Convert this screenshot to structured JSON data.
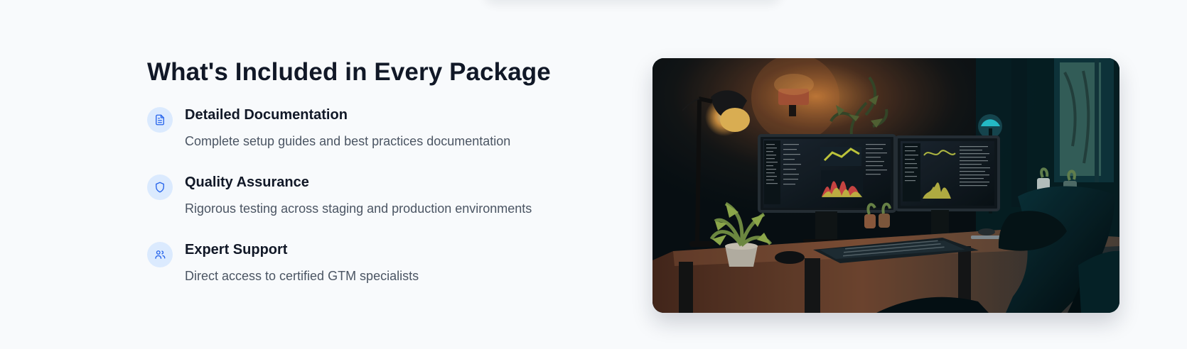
{
  "section": {
    "heading": "What's Included in Every Package",
    "features": [
      {
        "title": "Detailed Documentation",
        "description": "Complete setup guides and best practices documentation",
        "icon": "document-icon"
      },
      {
        "title": "Quality Assurance",
        "description": "Rigorous testing across staging and production environments",
        "icon": "shield-icon"
      },
      {
        "title": "Expert Support",
        "description": "Direct access to certified GTM specialists",
        "icon": "users-icon"
      }
    ]
  },
  "colors": {
    "background": "#f8fafc",
    "heading": "#111827",
    "body_text": "#4b5563",
    "icon_accent": "#2563eb",
    "icon_bg": "#dbeafe"
  },
  "image": {
    "subject": "dark home office desk with dual monitors and lamps"
  }
}
